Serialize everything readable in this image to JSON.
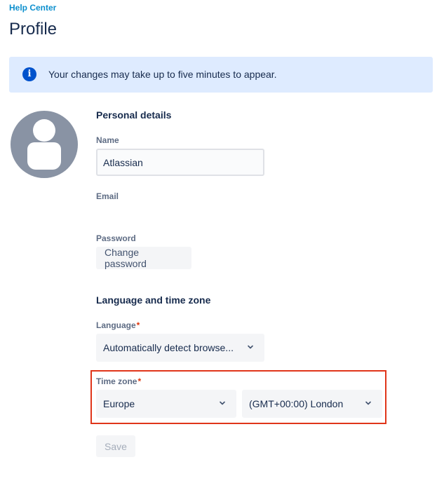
{
  "header": {
    "breadcrumb": "Help Center",
    "title": "Profile"
  },
  "banner": {
    "icon": "info-icon",
    "text": "Your changes may take up to five minutes to appear."
  },
  "avatar": {
    "icon": "user-avatar-icon"
  },
  "personal": {
    "heading": "Personal details",
    "name_label": "Name",
    "name_value": "Atlassian",
    "email_label": "Email",
    "password_label": "Password",
    "change_password": "Change password"
  },
  "locale": {
    "heading": "Language and time zone",
    "language_label": "Language",
    "language_value": "Automatically detect browse...",
    "timezone_label": "Time zone",
    "region_value": "Europe",
    "city_value": "(GMT+00:00) London",
    "required_mark": "*"
  },
  "actions": {
    "save": "Save"
  },
  "colors": {
    "accent": "#0c8fce",
    "banner_bg": "#deebff",
    "info_icon": "#0052cc",
    "highlight": "#e0351a",
    "required": "#de350b"
  }
}
